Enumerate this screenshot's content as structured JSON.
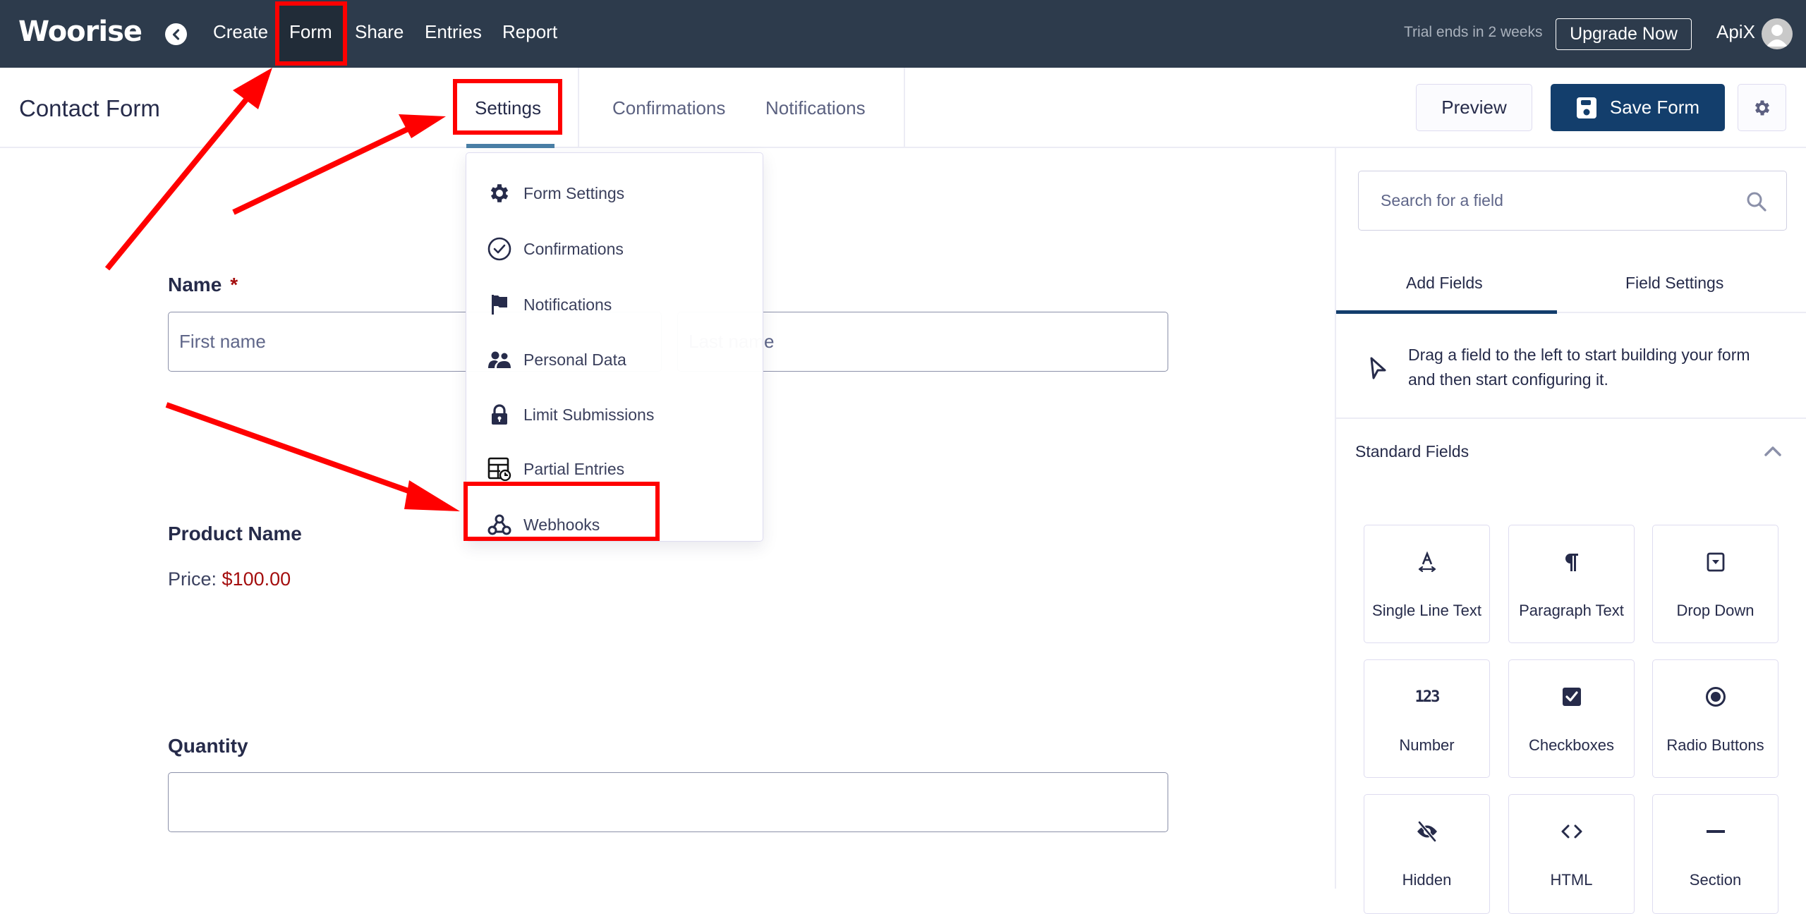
{
  "topbar": {
    "logo": "Woorise",
    "nav": [
      "Create",
      "Form",
      "Share",
      "Entries",
      "Report"
    ],
    "active_nav": "Form",
    "trial_text": "Trial ends in 2 weeks",
    "upgrade_label": "Upgrade Now",
    "username": "ApiX"
  },
  "subbar": {
    "form_title": "Contact Form",
    "tabs": [
      "Settings",
      "Confirmations",
      "Notifications"
    ],
    "active_tab": "Settings",
    "preview_label": "Preview",
    "save_label": "Save Form"
  },
  "settings_menu": {
    "items": [
      {
        "label": "Form Settings",
        "icon": "gear-icon"
      },
      {
        "label": "Confirmations",
        "icon": "check-circle-icon"
      },
      {
        "label": "Notifications",
        "icon": "flag-icon"
      },
      {
        "label": "Personal Data",
        "icon": "users-icon"
      },
      {
        "label": "Limit Submissions",
        "icon": "lock-icon"
      },
      {
        "label": "Partial Entries",
        "icon": "table-clock-icon"
      },
      {
        "label": "Webhooks",
        "icon": "webhook-icon"
      }
    ],
    "highlighted": "Webhooks"
  },
  "form": {
    "name_label": "Name",
    "name_required_mark": "*",
    "first_name_placeholder": "First name",
    "last_name_placeholder": "Last name",
    "product_label": "Product Name",
    "price_prefix": "Price:",
    "price_value": "$100.00",
    "quantity_label": "Quantity",
    "quantity_value": ""
  },
  "sidebar": {
    "search_placeholder": "Search for a field",
    "tabs": [
      "Add Fields",
      "Field Settings"
    ],
    "active_tab": "Add Fields",
    "hint": "Drag a field to the left to start building your form and then start configuring it.",
    "section_title": "Standard Fields",
    "fields": [
      {
        "label": "Single Line Text",
        "icon": "text-width-icon"
      },
      {
        "label": "Paragraph Text",
        "icon": "paragraph-icon"
      },
      {
        "label": "Drop Down",
        "icon": "dropdown-icon"
      },
      {
        "label": "Number",
        "icon": "numbers-icon"
      },
      {
        "label": "Checkboxes",
        "icon": "checkbox-icon"
      },
      {
        "label": "Radio Buttons",
        "icon": "radio-icon"
      },
      {
        "label": "Hidden",
        "icon": "eye-slash-icon"
      },
      {
        "label": "HTML",
        "icon": "code-icon"
      },
      {
        "label": "Section",
        "icon": "minus-icon"
      }
    ]
  },
  "colors": {
    "header_bg": "#2d3b4c",
    "primary": "#133e6c",
    "accent_underline": "#4a7fa6",
    "required": "#a40e0e",
    "annotation": "#ff0000"
  }
}
